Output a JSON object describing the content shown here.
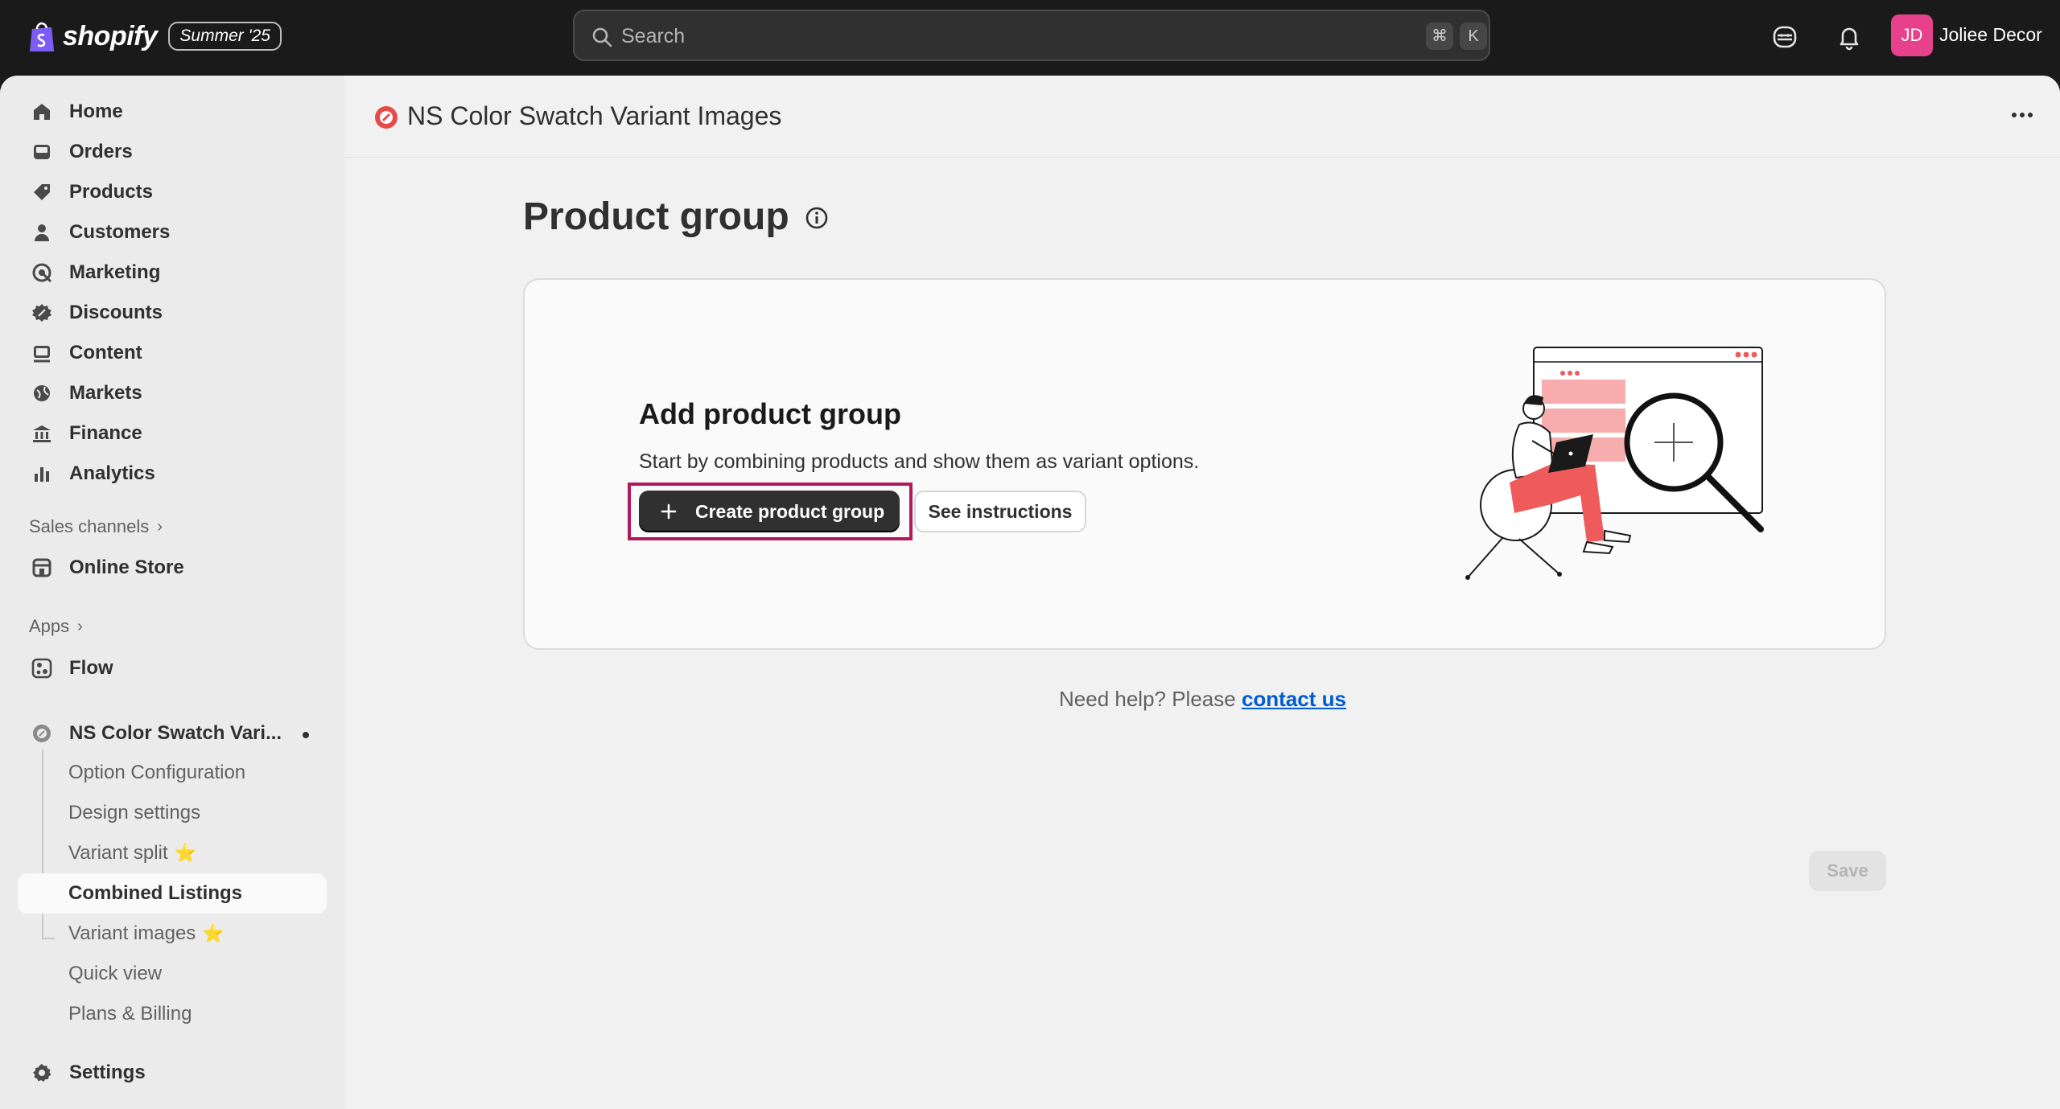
{
  "topbar": {
    "brand": "shopify",
    "edition_badge": "Summer '25",
    "search_placeholder": "Search",
    "shortcut_cmd": "⌘",
    "shortcut_key": "K",
    "avatar_initials": "JD",
    "store_name": "Joliee Decor",
    "avatar_color": "#e8418c"
  },
  "sidebar": {
    "items": [
      {
        "label": "Home",
        "icon": "home-icon"
      },
      {
        "label": "Orders",
        "icon": "inbox-icon"
      },
      {
        "label": "Products",
        "icon": "tag-icon"
      },
      {
        "label": "Customers",
        "icon": "person-icon"
      },
      {
        "label": "Marketing",
        "icon": "target-icon"
      },
      {
        "label": "Discounts",
        "icon": "discount-icon"
      },
      {
        "label": "Content",
        "icon": "image-icon"
      },
      {
        "label": "Markets",
        "icon": "globe-icon"
      },
      {
        "label": "Finance",
        "icon": "bank-icon"
      },
      {
        "label": "Analytics",
        "icon": "bar-chart-icon"
      }
    ],
    "sales_channels_label": "Sales channels",
    "online_store_label": "Online Store",
    "apps_label": "Apps",
    "flow_label": "Flow",
    "app_name": "NS Color Swatch Vari...",
    "app_subitems": [
      {
        "label": "Option Configuration"
      },
      {
        "label": "Design settings"
      },
      {
        "label": "Variant split"
      },
      {
        "label": "Combined Listings"
      },
      {
        "label": "Variant images"
      },
      {
        "label": "Quick view"
      },
      {
        "label": "Plans & Billing"
      }
    ],
    "settings_label": "Settings"
  },
  "main": {
    "app_title": "NS Color Swatch Variant Images",
    "page_title": "Product group",
    "card": {
      "title": "Add product group",
      "description": "Start by combining products and show them as variant options.",
      "primary_button": "Create product group",
      "secondary_button": "See instructions"
    },
    "help_prefix": "Need help? Please ",
    "help_link": "contact us",
    "save_label": "Save"
  },
  "colors": {
    "accent_red": "#ef5b5b",
    "highlight_border": "#b3195a",
    "link": "#005bd3"
  }
}
